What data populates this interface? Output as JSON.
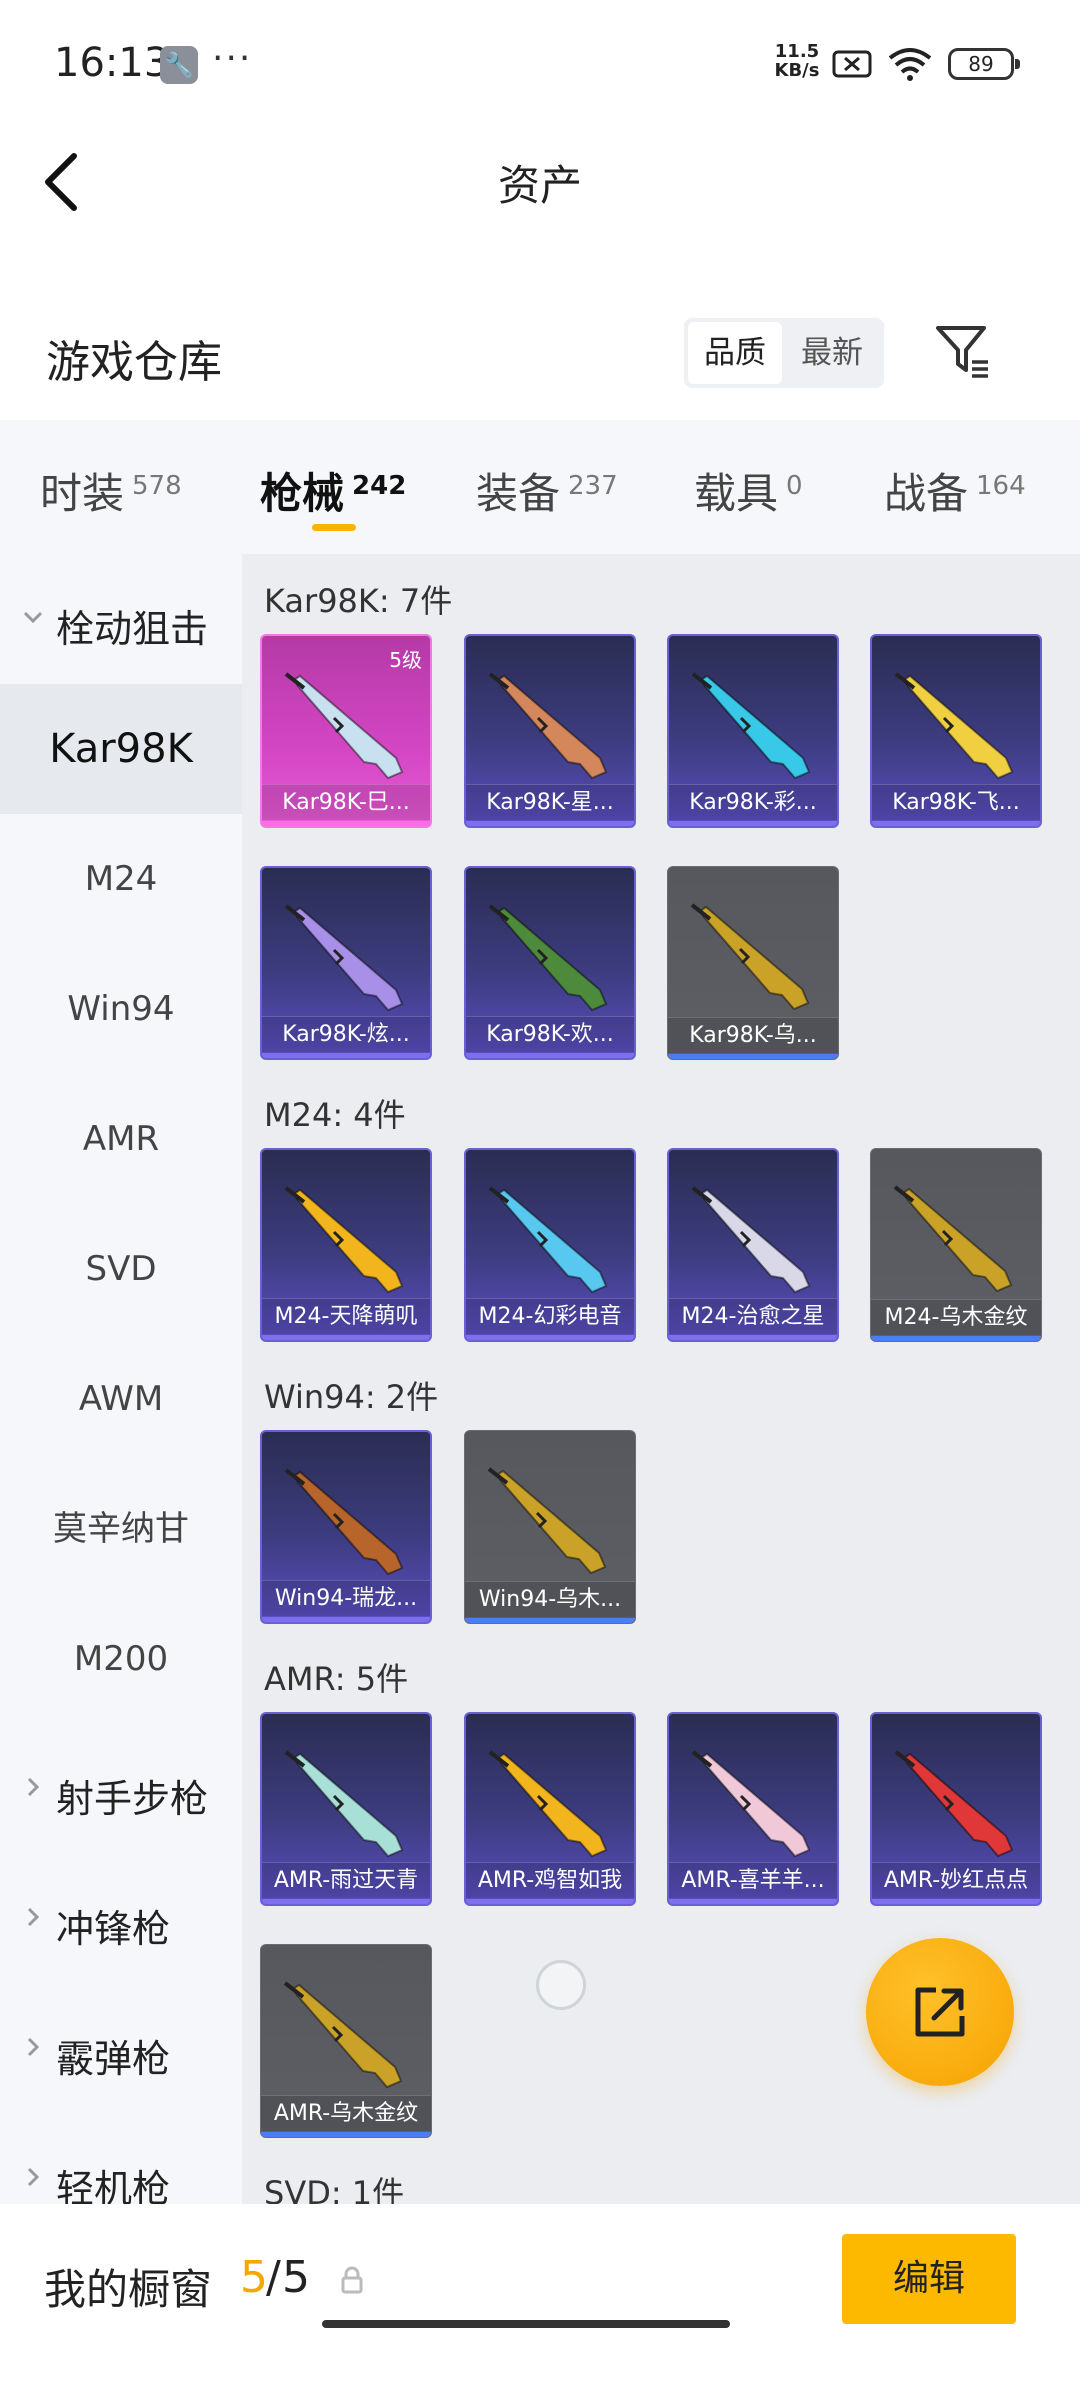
{
  "status_bar": {
    "time": "16:13",
    "dots": "···",
    "speed": "11.5\nKB/s",
    "battery": "89"
  },
  "header": {
    "title": "资产",
    "back_icon": "chevron-left-icon"
  },
  "warehouse": {
    "title": "游戏仓库",
    "sort_quality": "品质",
    "sort_newest": "最新",
    "filter_icon": "filter-icon"
  },
  "tabs": [
    {
      "label": "时装",
      "count": "578"
    },
    {
      "label": "枪械",
      "count": "242",
      "active": true
    },
    {
      "label": "装备",
      "count": "237"
    },
    {
      "label": "载具",
      "count": "0"
    },
    {
      "label": "战备",
      "count": "164"
    }
  ],
  "sidebar": {
    "group_sniper": "栓动狙击",
    "items": [
      "Kar98K",
      "M24",
      "Win94",
      "AMR",
      "SVD",
      "AWM",
      "莫辛纳甘",
      "M200"
    ],
    "group_marksman": "射手步枪",
    "group_smg": "冲锋枪",
    "group_shotgun": "霰弹枪",
    "group_lmg": "轻机枪"
  },
  "sections": [
    {
      "title": "Kar98K: 7件",
      "items": [
        {
          "name": "Kar98K-巳...",
          "rarity": "pink",
          "level": "5级",
          "color": "#c8e0f0"
        },
        {
          "name": "Kar98K-星...",
          "rarity": "purple",
          "color": "#d4875a"
        },
        {
          "name": "Kar98K-彩...",
          "rarity": "purple",
          "color": "#38c8e8"
        },
        {
          "name": "Kar98K-飞...",
          "rarity": "purple",
          "color": "#f0d040"
        },
        {
          "name": "Kar98K-炫...",
          "rarity": "purple",
          "color": "#a890e8"
        },
        {
          "name": "Kar98K-欢...",
          "rarity": "purple",
          "color": "#4e8a3c"
        },
        {
          "name": "Kar98K-乌...",
          "rarity": "gray",
          "color": "#c9a227"
        }
      ]
    },
    {
      "title": "M24: 4件",
      "items": [
        {
          "name": "M24-天降萌叽",
          "rarity": "purple",
          "color": "#f2b51e"
        },
        {
          "name": "M24-幻彩电音",
          "rarity": "purple",
          "color": "#58c8f0"
        },
        {
          "name": "M24-治愈之星",
          "rarity": "purple",
          "color": "#d8d8e8"
        },
        {
          "name": "M24-乌木金纹",
          "rarity": "gray",
          "color": "#c9a227"
        }
      ]
    },
    {
      "title": "Win94: 2件",
      "items": [
        {
          "name": "Win94-瑞龙...",
          "rarity": "purple",
          "color": "#b8652c"
        },
        {
          "name": "Win94-乌木...",
          "rarity": "gray",
          "color": "#c9a227"
        }
      ]
    },
    {
      "title": "AMR: 5件",
      "items": [
        {
          "name": "AMR-雨过天青",
          "rarity": "purple",
          "color": "#a8e0d8"
        },
        {
          "name": "AMR-鸡智如我",
          "rarity": "purple",
          "color": "#f2b51e"
        },
        {
          "name": "AMR-喜羊羊...",
          "rarity": "purple",
          "color": "#f0c8d8"
        },
        {
          "name": "AMR-妙红点点",
          "rarity": "purple",
          "color": "#e03838"
        },
        {
          "name": "AMR-乌木金纹",
          "rarity": "gray",
          "color": "#c9a227"
        }
      ]
    },
    {
      "title": "SVD: 1件",
      "items": []
    }
  ],
  "bottom": {
    "label": "我的橱窗",
    "used": "5",
    "sep": "/",
    "total": "5",
    "edit": "编辑"
  },
  "colors": {
    "accent": "#f7b500",
    "edit_button": "#fdb800"
  }
}
